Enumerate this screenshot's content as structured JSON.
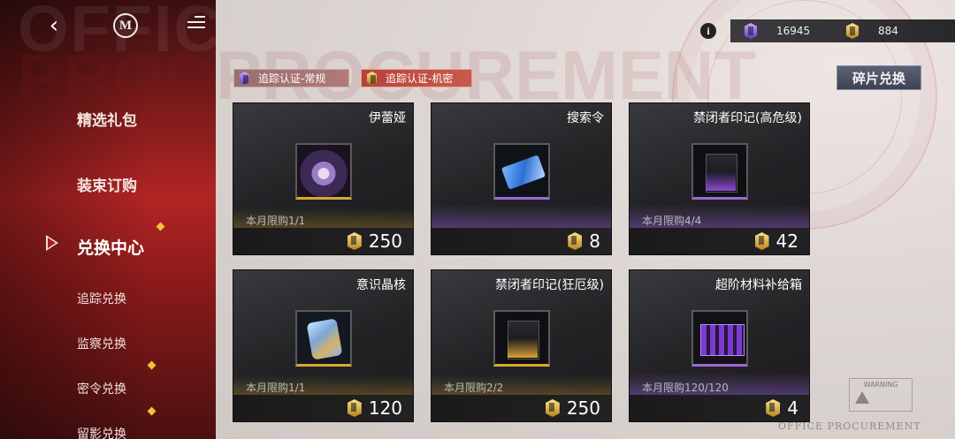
{
  "background": {
    "word_top": "OFFICE",
    "word_bottom": "PROCUREMENT",
    "footer_mark": "OFFICE PROCUREMENT",
    "warning_label": "WARNING"
  },
  "header": {
    "back_icon": "chevron-left-icon",
    "logo_letter": "M",
    "currencies": [
      {
        "icon": "purple-token-icon",
        "value": "16945",
        "color": "#9b6ad8"
      },
      {
        "icon": "gold-token-icon",
        "value": "884",
        "color": "#d6a92e"
      }
    ],
    "info_symbol": "i"
  },
  "sidebar": {
    "items": [
      {
        "label": "精选礼包"
      },
      {
        "label": "装束订购"
      },
      {
        "label": "兑换中心",
        "active": true
      },
      {
        "label": "追踪兑换"
      },
      {
        "label": "监察兑换"
      },
      {
        "label": "密令兑换"
      },
      {
        "label": "留影兑换"
      }
    ]
  },
  "tabs": [
    {
      "label": "追踪认证-常规",
      "icon": "purple-token-icon"
    },
    {
      "label": "追踪认证-机密",
      "icon": "gold-token-icon"
    }
  ],
  "fragment_exchange": {
    "label": "碎片兑换"
  },
  "cards": [
    {
      "name": "伊蕾娅",
      "limit": "本月限购1/1",
      "price": "250",
      "currency": "gold",
      "rarity": "gold"
    },
    {
      "name": "搜索令",
      "limit": "",
      "price": "8",
      "currency": "gold",
      "rarity": "purple"
    },
    {
      "name": "禁闭者印记(高危级)",
      "limit": "本月限购4/4",
      "price": "42",
      "currency": "gold",
      "rarity": "purple"
    },
    {
      "name": "意识晶核",
      "limit": "本月限购1/1",
      "price": "120",
      "currency": "gold",
      "rarity": "gold"
    },
    {
      "name": "禁闭者印记(狂厄级)",
      "limit": "本月限购2/2",
      "price": "250",
      "currency": "gold",
      "rarity": "gold"
    },
    {
      "name": "超阶材料补给箱",
      "limit": "本月限购120/120",
      "price": "4",
      "currency": "gold",
      "rarity": "purple"
    }
  ]
}
